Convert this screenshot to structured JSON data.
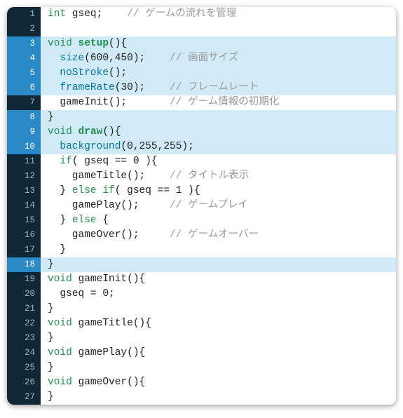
{
  "lines": [
    {
      "n": 1,
      "hl": false,
      "tokens": [
        [
          "kw",
          "int"
        ],
        [
          "txt",
          " gseq;    "
        ],
        [
          "cmt",
          "// ゲームの流れを管理"
        ]
      ]
    },
    {
      "n": 2,
      "hl": false,
      "tokens": []
    },
    {
      "n": 3,
      "hl": true,
      "tokens": [
        [
          "kw",
          "void"
        ],
        [
          "txt",
          " "
        ],
        [
          "fnk",
          "setup"
        ],
        [
          "txt",
          "(){"
        ]
      ]
    },
    {
      "n": 4,
      "hl": true,
      "tokens": [
        [
          "txt",
          "  "
        ],
        [
          "fn",
          "size"
        ],
        [
          "txt",
          "(600,450);    "
        ],
        [
          "cmt",
          "// 画面サイズ"
        ]
      ]
    },
    {
      "n": 5,
      "hl": true,
      "tokens": [
        [
          "txt",
          "  "
        ],
        [
          "fn",
          "noStroke"
        ],
        [
          "txt",
          "();"
        ]
      ]
    },
    {
      "n": 6,
      "hl": true,
      "tokens": [
        [
          "txt",
          "  "
        ],
        [
          "fn",
          "frameRate"
        ],
        [
          "txt",
          "(30);    "
        ],
        [
          "cmt",
          "// フレームレート"
        ]
      ]
    },
    {
      "n": 7,
      "hl": false,
      "tokens": [
        [
          "txt",
          "  gameInit();       "
        ],
        [
          "cmt",
          "// ゲーム情報の初期化"
        ]
      ]
    },
    {
      "n": 8,
      "hl": true,
      "tokens": [
        [
          "txt",
          "}"
        ]
      ]
    },
    {
      "n": 9,
      "hl": true,
      "tokens": [
        [
          "kw",
          "void"
        ],
        [
          "txt",
          " "
        ],
        [
          "fnk",
          "draw"
        ],
        [
          "txt",
          "(){"
        ]
      ]
    },
    {
      "n": 10,
      "hl": true,
      "tokens": [
        [
          "txt",
          "  "
        ],
        [
          "fn",
          "background"
        ],
        [
          "txt",
          "(0,255,255);"
        ]
      ]
    },
    {
      "n": 11,
      "hl": false,
      "tokens": [
        [
          "txt",
          "  "
        ],
        [
          "kw",
          "if"
        ],
        [
          "txt",
          "( gseq == 0 ){"
        ]
      ]
    },
    {
      "n": 12,
      "hl": false,
      "tokens": [
        [
          "txt",
          "    gameTitle();    "
        ],
        [
          "cmt",
          "// タイトル表示"
        ]
      ]
    },
    {
      "n": 13,
      "hl": false,
      "tokens": [
        [
          "txt",
          "  } "
        ],
        [
          "kw",
          "else if"
        ],
        [
          "txt",
          "( gseq == 1 ){"
        ]
      ]
    },
    {
      "n": 14,
      "hl": false,
      "tokens": [
        [
          "txt",
          "    gamePlay();     "
        ],
        [
          "cmt",
          "// ゲームプレイ"
        ]
      ]
    },
    {
      "n": 15,
      "hl": false,
      "tokens": [
        [
          "txt",
          "  } "
        ],
        [
          "kw",
          "else"
        ],
        [
          "txt",
          " {"
        ]
      ]
    },
    {
      "n": 16,
      "hl": false,
      "tokens": [
        [
          "txt",
          "    gameOver();     "
        ],
        [
          "cmt",
          "// ゲームオーバー"
        ]
      ]
    },
    {
      "n": 17,
      "hl": false,
      "tokens": [
        [
          "txt",
          "  }"
        ]
      ]
    },
    {
      "n": 18,
      "hl": true,
      "tokens": [
        [
          "txt",
          "}"
        ]
      ]
    },
    {
      "n": 19,
      "hl": false,
      "tokens": [
        [
          "kw",
          "void"
        ],
        [
          "txt",
          " gameInit(){"
        ]
      ]
    },
    {
      "n": 20,
      "hl": false,
      "tokens": [
        [
          "txt",
          "  gseq = 0;"
        ]
      ]
    },
    {
      "n": 21,
      "hl": false,
      "tokens": [
        [
          "txt",
          "}"
        ]
      ]
    },
    {
      "n": 22,
      "hl": false,
      "tokens": [
        [
          "kw",
          "void"
        ],
        [
          "txt",
          " gameTitle(){"
        ]
      ]
    },
    {
      "n": 23,
      "hl": false,
      "tokens": [
        [
          "txt",
          "}"
        ]
      ]
    },
    {
      "n": 24,
      "hl": false,
      "tokens": [
        [
          "kw",
          "void"
        ],
        [
          "txt",
          " gamePlay(){"
        ]
      ]
    },
    {
      "n": 25,
      "hl": false,
      "tokens": [
        [
          "txt",
          "}"
        ]
      ]
    },
    {
      "n": 26,
      "hl": false,
      "tokens": [
        [
          "kw",
          "void"
        ],
        [
          "txt",
          " gameOver(){"
        ]
      ]
    },
    {
      "n": 27,
      "hl": false,
      "tokens": [
        [
          "txt",
          "}"
        ]
      ]
    }
  ]
}
